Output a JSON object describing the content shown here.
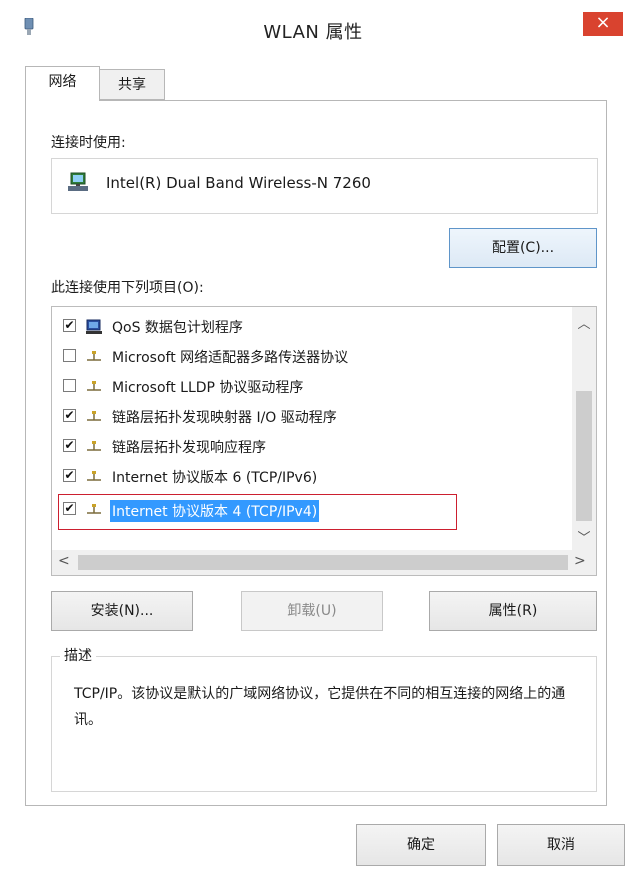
{
  "window": {
    "title": "WLAN 属性",
    "close_label": "×"
  },
  "tabs": [
    {
      "label": "网络"
    },
    {
      "label": "共享"
    }
  ],
  "connect_using": {
    "label": "连接时使用:",
    "device": "Intel(R) Dual Band Wireless-N 7260",
    "configure_button": "配置(C)..."
  },
  "items_section": {
    "label": "此连接使用下列项目(O):",
    "items": [
      {
        "checked": "✔",
        "icon": "qos-packet-icon",
        "label": "QoS 数据包计划程序"
      },
      {
        "checked": "",
        "icon": "network-protocol-icon",
        "label": "Microsoft 网络适配器多路传送器协议"
      },
      {
        "checked": "",
        "icon": "network-protocol-icon",
        "label": "Microsoft LLDP 协议驱动程序"
      },
      {
        "checked": "✔",
        "icon": "network-protocol-icon",
        "label": "链路层拓扑发现映射器 I/O 驱动程序"
      },
      {
        "checked": "✔",
        "icon": "network-protocol-icon",
        "label": "链路层拓扑发现响应程序"
      },
      {
        "checked": "✔",
        "icon": "network-protocol-icon",
        "label": "Internet 协议版本 6 (TCP/IPv6)"
      },
      {
        "checked": "✔",
        "icon": "network-protocol-icon",
        "label": "Internet 协议版本 4 (TCP/IPv4)"
      }
    ],
    "selected_index": 6
  },
  "actions": {
    "install": "安装(N)...",
    "uninstall": "卸载(U)",
    "properties": "属性(R)"
  },
  "description": {
    "legend": "描述",
    "text": "TCP/IP。该协议是默认的广域网络协议，它提供在不同的相互连接的网络上的通讯。"
  },
  "footer": {
    "ok": "确定",
    "cancel": "取消"
  },
  "colors": {
    "selection": "#3399ff",
    "highlight_border": "#cc1f2f",
    "close": "#d9432f"
  }
}
